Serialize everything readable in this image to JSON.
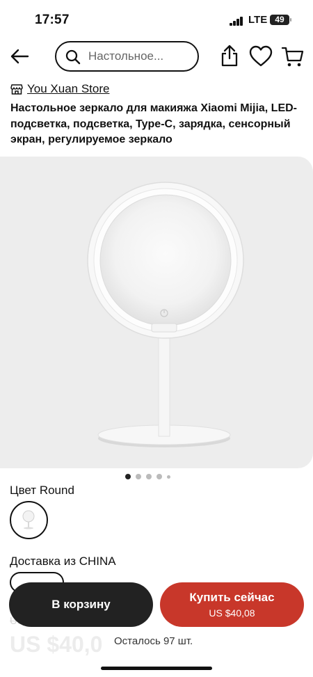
{
  "status_bar": {
    "time": "17:57",
    "network": "LTE",
    "battery": "49"
  },
  "search": {
    "text": "Настольное..."
  },
  "store": {
    "name": "You Xuan Store"
  },
  "product": {
    "title": "Настольное зеркало для макияжа Xiaomi Mijia, LED-подсветка, подсветка, Type-C, зарядка, сенсорный экран, регулируемое зеркало"
  },
  "gallery": {
    "image_count": 5,
    "active_index": 0
  },
  "variant": {
    "color_label": "Цвет Round"
  },
  "shipping": {
    "label": "Доставка из CHINA"
  },
  "ghost": {
    "old_price": "US $58.54",
    "price": "US $40,0"
  },
  "actions": {
    "cart_label": "В корзину",
    "buy_label": "Купить сейчас",
    "buy_price": "US $40,08"
  },
  "stock": {
    "note": "Осталось 97 шт."
  },
  "colors": {
    "accent": "#c8372a",
    "dark_button": "#222222",
    "gallery_bg": "#ededed"
  }
}
